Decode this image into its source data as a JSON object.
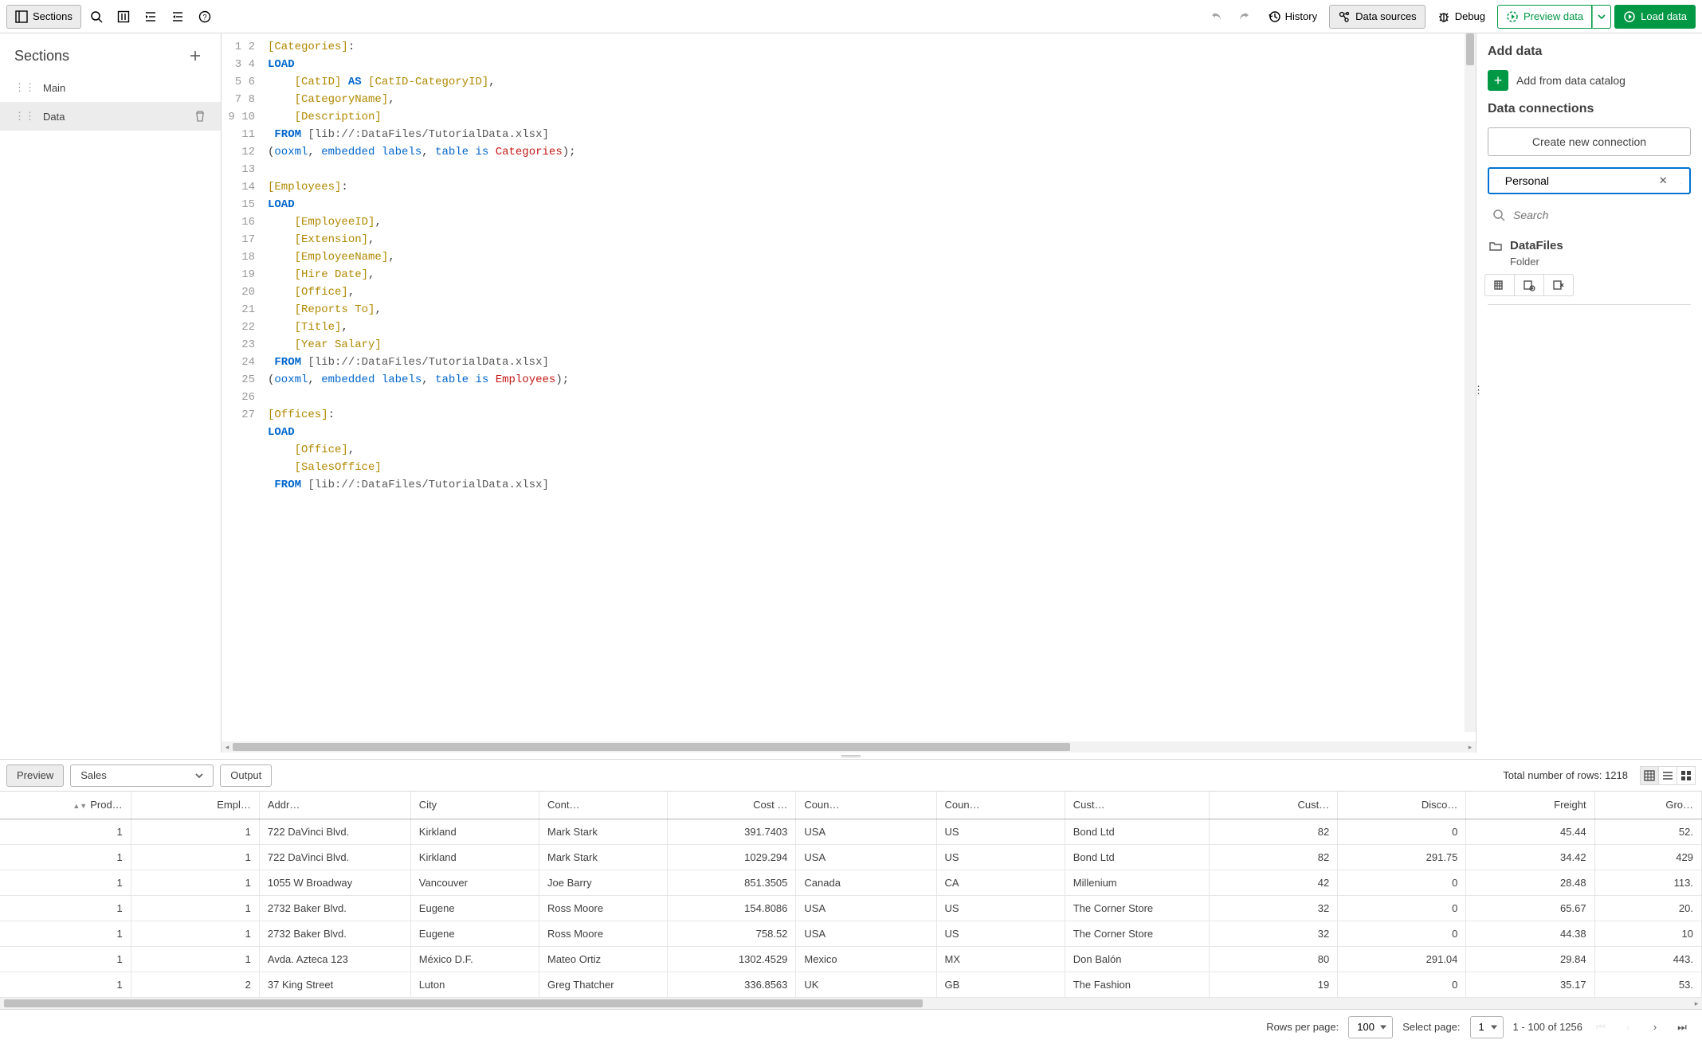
{
  "toolbar": {
    "sections_label": "Sections",
    "history_label": "History",
    "data_sources_label": "Data sources",
    "debug_label": "Debug",
    "preview_label": "Preview data",
    "load_label": "Load data"
  },
  "sections_panel": {
    "title": "Sections",
    "items": [
      {
        "label": "Main"
      },
      {
        "label": "Data"
      }
    ]
  },
  "editor": {
    "lines": [
      {
        "n": 1,
        "html": "<span class='t-sec'>[Categories]</span>:"
      },
      {
        "n": 2,
        "html": "<span class='t-kw'>LOAD</span>"
      },
      {
        "n": 3,
        "html": "    <span class='t-field'>[CatID]</span> <span class='t-kw'>AS</span> <span class='t-field'>[CatID-CategoryID]</span>,"
      },
      {
        "n": 4,
        "html": "    <span class='t-field'>[CategoryName]</span>,"
      },
      {
        "n": 5,
        "html": "    <span class='t-field'>[Description]</span>"
      },
      {
        "n": 6,
        "html": " <span class='t-kw'>FROM</span> <span class='t-str'>[lib://:DataFiles/TutorialData.xlsx]</span>"
      },
      {
        "n": 7,
        "html": "(<span class='t-arg'>ooxml</span>, <span class='t-arg'>embedded labels</span>, <span class='t-arg'>table is</span> <span class='t-id'>Categories</span>);"
      },
      {
        "n": 8,
        "html": ""
      },
      {
        "n": 9,
        "html": "<span class='t-sec'>[Employees]</span>:"
      },
      {
        "n": 10,
        "html": "<span class='t-kw'>LOAD</span>"
      },
      {
        "n": 11,
        "html": "    <span class='t-field'>[EmployeeID]</span>,"
      },
      {
        "n": 12,
        "html": "    <span class='t-field'>[Extension]</span>,"
      },
      {
        "n": 13,
        "html": "    <span class='t-field'>[EmployeeName]</span>,"
      },
      {
        "n": 14,
        "html": "    <span class='t-field'>[Hire Date]</span>,"
      },
      {
        "n": 15,
        "html": "    <span class='t-field'>[Office]</span>,"
      },
      {
        "n": 16,
        "html": "    <span class='t-field'>[Reports To]</span>,"
      },
      {
        "n": 17,
        "html": "    <span class='t-field'>[Title]</span>,"
      },
      {
        "n": 18,
        "html": "    <span class='t-field'>[Year Salary]</span>"
      },
      {
        "n": 19,
        "html": " <span class='t-kw'>FROM</span> <span class='t-str'>[lib://:DataFiles/TutorialData.xlsx]</span>"
      },
      {
        "n": 20,
        "html": "(<span class='t-arg'>ooxml</span>, <span class='t-arg'>embedded labels</span>, <span class='t-arg'>table is</span> <span class='t-id'>Employees</span>);"
      },
      {
        "n": 21,
        "html": ""
      },
      {
        "n": 22,
        "html": "<span class='t-sec'>[Offices]</span>:"
      },
      {
        "n": 23,
        "html": "<span class='t-kw'>LOAD</span>"
      },
      {
        "n": 24,
        "html": "    <span class='t-field'>[Office]</span>,"
      },
      {
        "n": 25,
        "html": "    <span class='t-field'>[SalesOffice]</span>"
      },
      {
        "n": 26,
        "html": " <span class='t-kw'>FROM</span> <span class='t-str'>[lib://:DataFiles/TutorialData.xlsx]</span>"
      },
      {
        "n": 27,
        "html": ""
      }
    ]
  },
  "right_panel": {
    "add_data_title": "Add data",
    "catalog_label": "Add from data catalog",
    "connections_title": "Data connections",
    "create_label": "Create new connection",
    "space_value": "Personal",
    "search_placeholder": "Search",
    "conn": {
      "name": "DataFiles",
      "type": "Folder"
    }
  },
  "preview": {
    "preview_tab": "Preview",
    "output_tab": "Output",
    "table_select": "Sales",
    "rows_label": "Total number of rows: 1218",
    "columns": [
      "Prod…",
      "Empl…",
      "Addr…",
      "City",
      "Cont…",
      "Cost …",
      "Coun…",
      "Coun…",
      "Cust…",
      "Cust…",
      "Disco…",
      "Freight",
      "Gro…"
    ],
    "rows": [
      {
        "prod": "1",
        "emp": "1",
        "addr": "722 DaVinci Blvd.",
        "city": "Kirkland",
        "cont": "Mark Stark",
        "cost": "391.7403",
        "coun": "USA",
        "cc": "US",
        "cust": "Bond Ltd",
        "custn": "82",
        "disc": "0",
        "freight": "45.44",
        "last": "52."
      },
      {
        "prod": "1",
        "emp": "1",
        "addr": "722 DaVinci Blvd.",
        "city": "Kirkland",
        "cont": "Mark Stark",
        "cost": "1029.294",
        "coun": "USA",
        "cc": "US",
        "cust": "Bond Ltd",
        "custn": "82",
        "disc": "291.75",
        "freight": "34.42",
        "last": "429"
      },
      {
        "prod": "1",
        "emp": "1",
        "addr": "1055 W Broadway",
        "city": "Vancouver",
        "cont": "Joe Barry",
        "cost": "851.3505",
        "coun": "Canada",
        "cc": "CA",
        "cust": "Millenium",
        "custn": "42",
        "disc": "0",
        "freight": "28.48",
        "last": "113."
      },
      {
        "prod": "1",
        "emp": "1",
        "addr": "2732 Baker Blvd.",
        "city": "Eugene",
        "cont": "Ross Moore",
        "cost": "154.8086",
        "coun": "USA",
        "cc": "US",
        "cust": "The Corner Store",
        "custn": "32",
        "disc": "0",
        "freight": "65.67",
        "last": "20."
      },
      {
        "prod": "1",
        "emp": "1",
        "addr": "2732 Baker Blvd.",
        "city": "Eugene",
        "cont": "Ross Moore",
        "cost": "758.52",
        "coun": "USA",
        "cc": "US",
        "cust": "The Corner Store",
        "custn": "32",
        "disc": "0",
        "freight": "44.38",
        "last": "10"
      },
      {
        "prod": "1",
        "emp": "1",
        "addr": "Avda. Azteca 123",
        "city": "México D.F.",
        "cont": "Mateo Ortiz",
        "cost": "1302.4529",
        "coun": "Mexico",
        "cc": "MX",
        "cust": "Don Balón",
        "custn": "80",
        "disc": "291.04",
        "freight": "29.84",
        "last": "443."
      },
      {
        "prod": "1",
        "emp": "2",
        "addr": "37 King Street",
        "city": "Luton",
        "cont": "Greg Thatcher",
        "cost": "336.8563",
        "coun": "UK",
        "cc": "GB",
        "cust": "The Fashion",
        "custn": "19",
        "disc": "0",
        "freight": "35.17",
        "last": "53."
      }
    ]
  },
  "footer": {
    "rows_per_page_label": "Rows per page:",
    "rows_per_page_value": "100",
    "select_page_label": "Select page:",
    "select_page_value": "1",
    "range_label": "1 - 100 of 1256"
  }
}
